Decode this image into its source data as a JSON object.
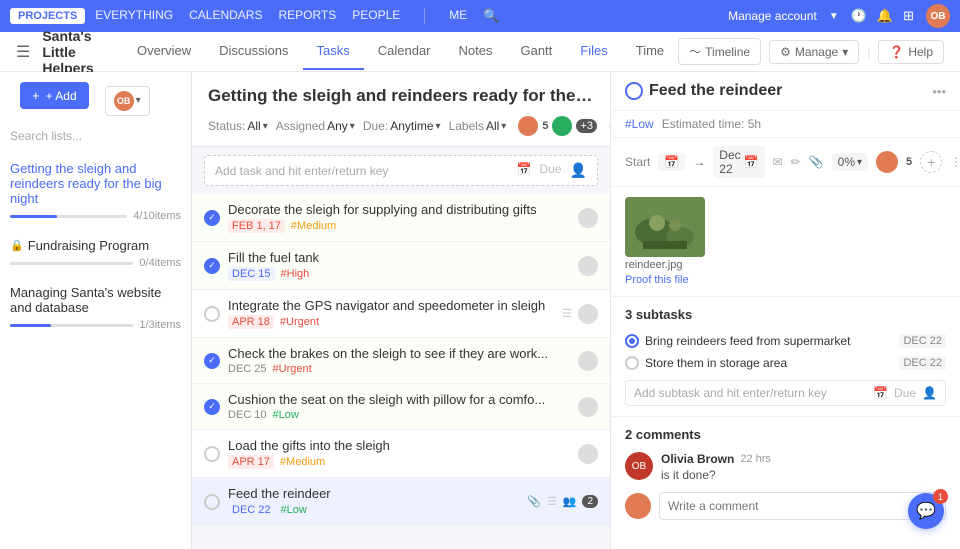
{
  "topnav": {
    "projects_label": "PROJECTS",
    "everything_label": "EVERYTHING",
    "calendars_label": "CALENDARS",
    "reports_label": "REPORTS",
    "people_label": "PEOPLE",
    "me_label": "ME",
    "manage_account_label": "Manage account",
    "avatar_initials": "OB"
  },
  "secondnav": {
    "project_title": "Santa's Little Helpers",
    "tabs": [
      "Overview",
      "Discussions",
      "Tasks",
      "Calendar",
      "Notes",
      "Gantt",
      "Files",
      "Time"
    ],
    "active_tab": "Tasks",
    "files_tab": "Files",
    "timeline_label": "Timeline",
    "manage_label": "Manage",
    "help_label": "Help"
  },
  "sidebar": {
    "add_label": "+ Add",
    "search_placeholder": "Search lists...",
    "lists": [
      {
        "name": "Getting the sleigh and reindeers ready for the big night",
        "progress": 40,
        "items_label": "4/10items",
        "locked": false,
        "active": true
      },
      {
        "name": "Fundraising Program",
        "progress": 0,
        "items_label": "0/4items",
        "locked": true,
        "active": false
      },
      {
        "name": "Managing Santa's website and database",
        "progress": 33,
        "items_label": "1/3items",
        "locked": false,
        "active": false
      }
    ]
  },
  "tasklist": {
    "title": "Getting the sleigh and reindeers ready for the big...",
    "filters": {
      "status_label": "Status:",
      "status_val": "All",
      "assigned_label": "Assigned",
      "assigned_val": "Any",
      "due_label": "Due:",
      "due_val": "Anytime",
      "labels_label": "Labels",
      "labels_val": "All"
    },
    "add_task_placeholder": "Add task and hit enter/return key",
    "due_label": "Due",
    "tasks": [
      {
        "name": "Decorate the sleigh for supplying and distributing gifts",
        "date": "FEB 1, 17",
        "date_style": "red",
        "tag": "#Medium",
        "tag_style": "medium",
        "done": true,
        "icons": []
      },
      {
        "name": "Fill the fuel tank",
        "date": "DEC 15",
        "date_style": "blue",
        "tag": "#High",
        "tag_style": "high",
        "done": true,
        "icons": []
      },
      {
        "name": "Integrate the GPS navigator and speedometer in sleigh",
        "date": "APR 18",
        "date_style": "red",
        "tag": "#Urgent",
        "tag_style": "urgent",
        "done": false,
        "icons": [
          "list",
          "person"
        ]
      },
      {
        "name": "Check the brakes on the sleigh to see if they are work...",
        "date": "DEC 25",
        "date_style": "normal",
        "tag": "#Urgent",
        "tag_style": "urgent",
        "done": true,
        "icons": []
      },
      {
        "name": "Cushion the seat on the sleigh with pillow for a comfo...",
        "date": "DEC 10",
        "date_style": "normal",
        "tag": "#Low",
        "tag_style": "low",
        "done": true,
        "icons": []
      },
      {
        "name": "Load the gifts into the sleigh",
        "date": "APR 17",
        "date_style": "red",
        "tag": "#Medium",
        "tag_style": "medium",
        "done": false,
        "icons": []
      },
      {
        "name": "Feed the reindeer",
        "date": "DEC 22",
        "date_style": "blue",
        "tag": "#Low",
        "tag_style": "low",
        "done": false,
        "icons": [
          "attach",
          "list",
          "people"
        ],
        "badge": "2",
        "active": true
      }
    ]
  },
  "detail": {
    "title": "Feed the reindeer",
    "tag": "#Low",
    "estimated": "Estimated time: 5h",
    "start_label": "Start",
    "arrow": "→",
    "date": "Dec 22",
    "percent": "0%",
    "image_filename": "reindeer.jpg",
    "proof_link": "Proof this file",
    "subtasks_title": "3 subtasks",
    "subtasks": [
      {
        "name": "Bring reindeers feed from supermarket",
        "date": "DEC 22",
        "done": true
      },
      {
        "name": "Store them in storage area",
        "date": "DEC 22",
        "done": false
      }
    ],
    "add_subtask_placeholder": "Add subtask and hit enter/return key",
    "due_label": "Due",
    "comments_title": "2 comments",
    "comments": [
      {
        "name": "Olivia Brown",
        "time": "22 hrs",
        "text": "is it done?",
        "avatar_initials": "OB"
      }
    ],
    "comment_placeholder": "Write a comment",
    "chat_badge": "1"
  }
}
